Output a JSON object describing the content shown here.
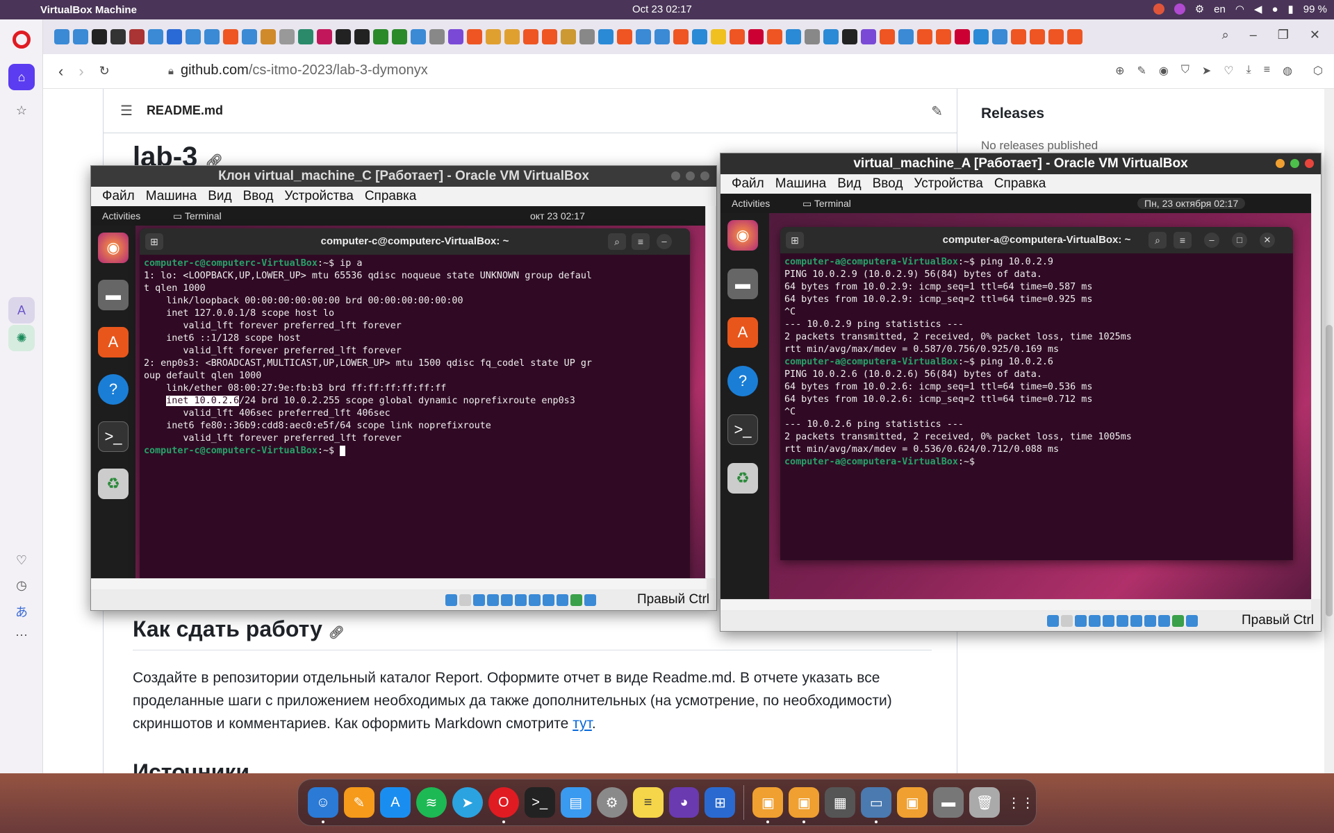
{
  "menubar": {
    "app_name": "VirtualBox Machine",
    "clock": "Oct 23  02:17",
    "lang": "en",
    "battery": "99 %"
  },
  "browser": {
    "url_host": "github.com",
    "url_path": "/cs-itmo-2023/lab-3-dymonyx"
  },
  "readme": {
    "file_name": "README.md",
    "heading_top": "lab-3",
    "heading_submit": "Как сдать работу",
    "paragraph_main": "Создайте в репозитории отдельный каталог Report. Оформите отчет в виде Readme.md. В отчете указать все проделанные шаги с приложением необходимых да также дополнительных (на усмотрение, по необходимости) скриншотов и комментариев. Как оформить Markdown смотрите ",
    "paragraph_link": "тут",
    "paragraph_end": ".",
    "heading_sources": "Источники"
  },
  "sidebar_right": {
    "releases_title": "Releases",
    "no_releases": "No releases published"
  },
  "vm_c": {
    "window_title": "Клон virtual_machine_C [Работает] - Oracle VM VirtualBox",
    "menu": [
      "Файл",
      "Машина",
      "Вид",
      "Ввод",
      "Устройства",
      "Справка"
    ],
    "activities": "Activities",
    "terminal_label": "Terminal",
    "guest_clock": "окт 23  02:17",
    "term_title": "computer-c@computerc-VirtualBox: ~",
    "prompt": "computer-c@computerc-VirtualBox",
    "prompt_suffix": ":~$ ",
    "command": "ip a",
    "line1": "1: lo: <LOOPBACK,UP,LOWER_UP> mtu 65536 qdisc noqueue state UNKNOWN group defaul",
    "line2": "t qlen 1000",
    "line3": "    link/loopback 00:00:00:00:00:00 brd 00:00:00:00:00:00",
    "line4": "    inet 127.0.0.1/8 scope host lo",
    "line5": "       valid_lft forever preferred_lft forever",
    "line6": "    inet6 ::1/128 scope host",
    "line7": "       valid_lft forever preferred_lft forever",
    "line8": "2: enp0s3: <BROADCAST,MULTICAST,UP,LOWER_UP> mtu 1500 qdisc fq_codel state UP gr",
    "line9": "oup default qlen 1000",
    "line10": "    link/ether 08:00:27:9e:fb:b3 brd ff:ff:ff:ff:ff:ff",
    "line11_pre": "    ",
    "line11_hl": "inet 10.0.2.6",
    "line11_post": "/24 brd 10.0.2.255 scope global dynamic noprefixroute enp0s3",
    "line12": "       valid_lft 406sec preferred_lft 406sec",
    "line13": "    inet6 fe80::36b9:cdd8:aec0:e5f/64 scope link noprefixroute",
    "line14": "       valid_lft forever preferred_lft forever",
    "host_key": "Правый Ctrl"
  },
  "vm_a": {
    "window_title": "virtual_machine_A [Работает] - Oracle VM VirtualBox",
    "menu": [
      "Файл",
      "Машина",
      "Вид",
      "Ввод",
      "Устройства",
      "Справка"
    ],
    "activities": "Activities",
    "terminal_label": "Terminal",
    "guest_clock": "Пн, 23 октября  02:17",
    "term_title": "computer-a@computera-VirtualBox: ~",
    "prompt": "computer-a@computera-VirtualBox",
    "prompt_suffix": ":~$ ",
    "command1": "ping 10.0.2.9",
    "l1": "PING 10.0.2.9 (10.0.2.9) 56(84) bytes of data.",
    "l2": "64 bytes from 10.0.2.9: icmp_seq=1 ttl=64 time=0.587 ms",
    "l3": "64 bytes from 10.0.2.9: icmp_seq=2 ttl=64 time=0.925 ms",
    "l4": "^C",
    "l5": "--- 10.0.2.9 ping statistics ---",
    "l6": "2 packets transmitted, 2 received, 0% packet loss, time 1025ms",
    "l7": "rtt min/avg/max/mdev = 0.587/0.756/0.925/0.169 ms",
    "command2": "ping 10.0.2.6",
    "m1": "PING 10.0.2.6 (10.0.2.6) 56(84) bytes of data.",
    "m2": "64 bytes from 10.0.2.6: icmp_seq=1 ttl=64 time=0.536 ms",
    "m3": "64 bytes from 10.0.2.6: icmp_seq=2 ttl=64 time=0.712 ms",
    "m4": "^C",
    "m5": "--- 10.0.2.6 ping statistics ---",
    "m6": "2 packets transmitted, 2 received, 0% packet loss, time 1005ms",
    "m7": "rtt min/avg/max/mdev = 0.536/0.624/0.712/0.088 ms",
    "host_key": "Правый Ctrl"
  },
  "colors": {
    "prompt_green": "#26a269",
    "terminal_bg": "#300a24",
    "link_blue": "#0969da"
  }
}
